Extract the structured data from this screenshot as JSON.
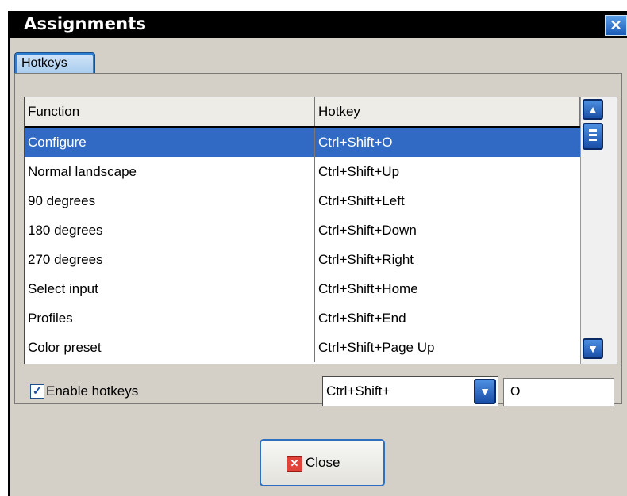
{
  "window": {
    "title": "Assignments",
    "close_glyph": "✕"
  },
  "tabs": [
    {
      "label": "Hotkeys",
      "active": true
    }
  ],
  "table": {
    "columns": [
      "Function",
      "Hotkey"
    ],
    "rows": [
      {
        "function": "Configure",
        "hotkey": "Ctrl+Shift+O",
        "selected": true
      },
      {
        "function": "Normal landscape",
        "hotkey": "Ctrl+Shift+Up"
      },
      {
        "function": "90 degrees",
        "hotkey": "Ctrl+Shift+Left"
      },
      {
        "function": "180 degrees",
        "hotkey": "Ctrl+Shift+Down"
      },
      {
        "function": "270 degrees",
        "hotkey": "Ctrl+Shift+Right"
      },
      {
        "function": "Select input",
        "hotkey": "Ctrl+Shift+Home"
      },
      {
        "function": "Profiles",
        "hotkey": "Ctrl+Shift+End"
      },
      {
        "function": "Color preset",
        "hotkey": "Ctrl+Shift+Page Up"
      }
    ]
  },
  "controls": {
    "enable_hotkeys_label": "Enable hotkeys",
    "enable_hotkeys_checked": true,
    "modifier_value": "Ctrl+Shift+",
    "key_value": "O"
  },
  "buttons": {
    "close_label": "Close"
  },
  "icons": {
    "window_close": "close-icon",
    "scroll_up": "arrow-up-icon",
    "scroll_down": "arrow-down-icon",
    "dropdown": "chevron-down-icon",
    "checkbox": "checkmark-icon",
    "close_button": "close-x-icon"
  },
  "colors": {
    "titlebar": "#000000",
    "selection": "#316ac5",
    "accent": "#2f7fd0",
    "close_icon": "#e0433a"
  }
}
